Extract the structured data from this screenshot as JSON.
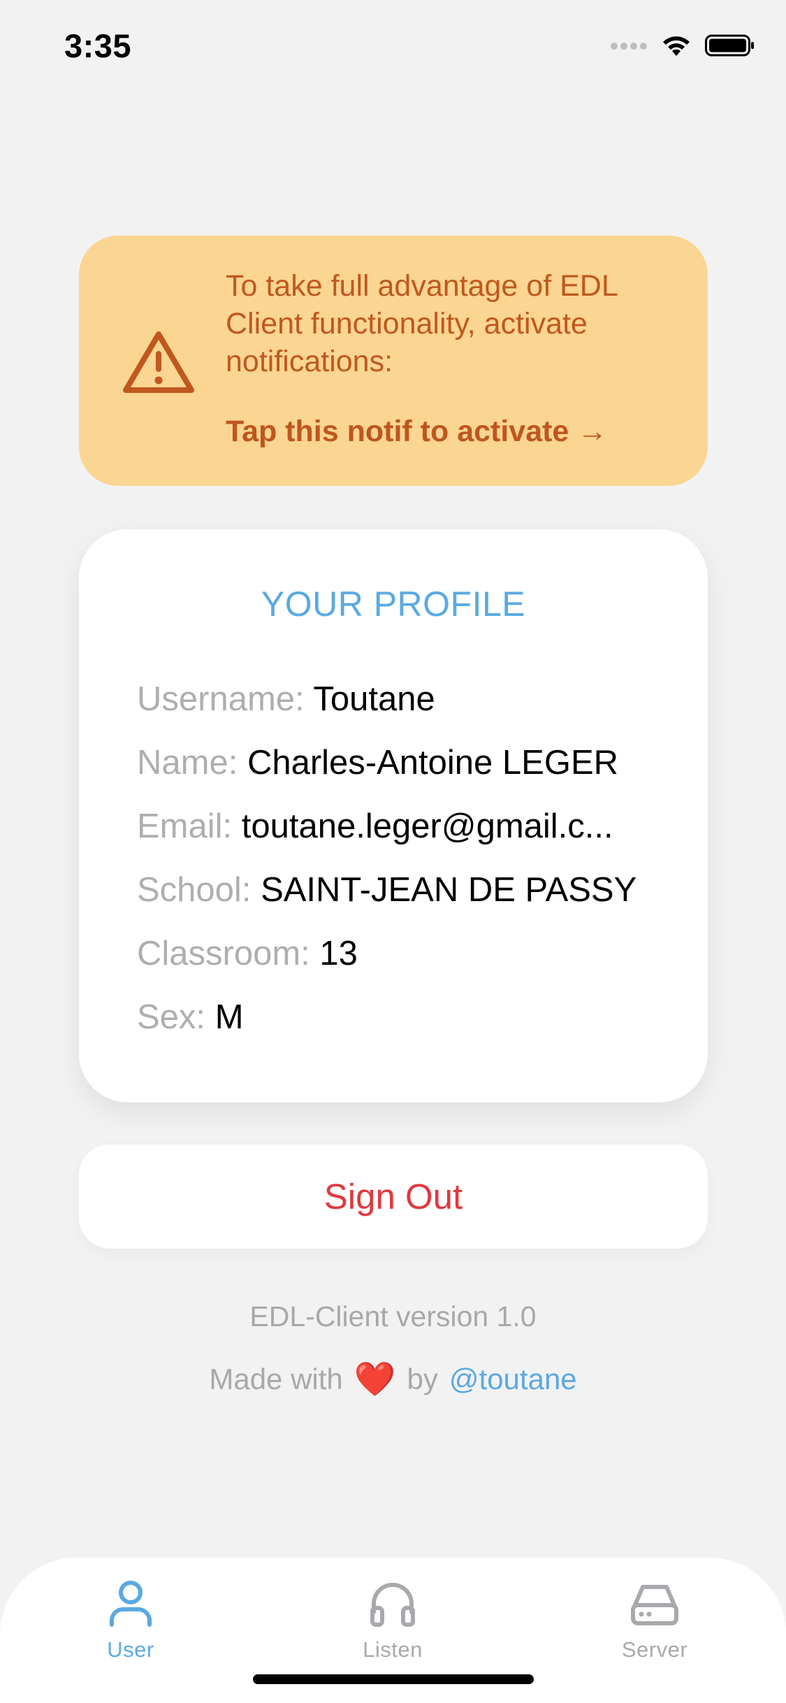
{
  "status_bar": {
    "time": "3:35"
  },
  "notification": {
    "message": "To take full advantage of EDL Client functionality, activate notifications:",
    "cta": "Tap this notif to activate →",
    "icon": "warning-triangle-icon",
    "text_color": "#c0581e",
    "background": "#fbd592"
  },
  "profile": {
    "title": "YOUR PROFILE",
    "rows": [
      {
        "label": "Username:",
        "value": "Toutane"
      },
      {
        "label": "Name:",
        "value": "Charles-Antoine LEGER"
      },
      {
        "label": "Email:",
        "value": "toutane.leger@gmail.c..."
      },
      {
        "label": "School:",
        "value": "SAINT-JEAN DE PASSY"
      },
      {
        "label": "Classroom:",
        "value": "13"
      },
      {
        "label": "Sex:",
        "value": "M"
      }
    ]
  },
  "signout": {
    "label": "Sign Out",
    "color": "#e0383f"
  },
  "footer": {
    "version": "EDL-Client version 1.0",
    "made_with": "Made with",
    "heart": "❤️",
    "by": "by",
    "handle": "@toutane"
  },
  "tabs": [
    {
      "label": "User",
      "icon": "user-icon",
      "active": true
    },
    {
      "label": "Listen",
      "icon": "headphones-icon",
      "active": false
    },
    {
      "label": "Server",
      "icon": "server-icon",
      "active": false
    }
  ],
  "colors": {
    "accent": "#5aa9e3",
    "background": "#f2f2f2",
    "muted": "#aeaeb2"
  }
}
